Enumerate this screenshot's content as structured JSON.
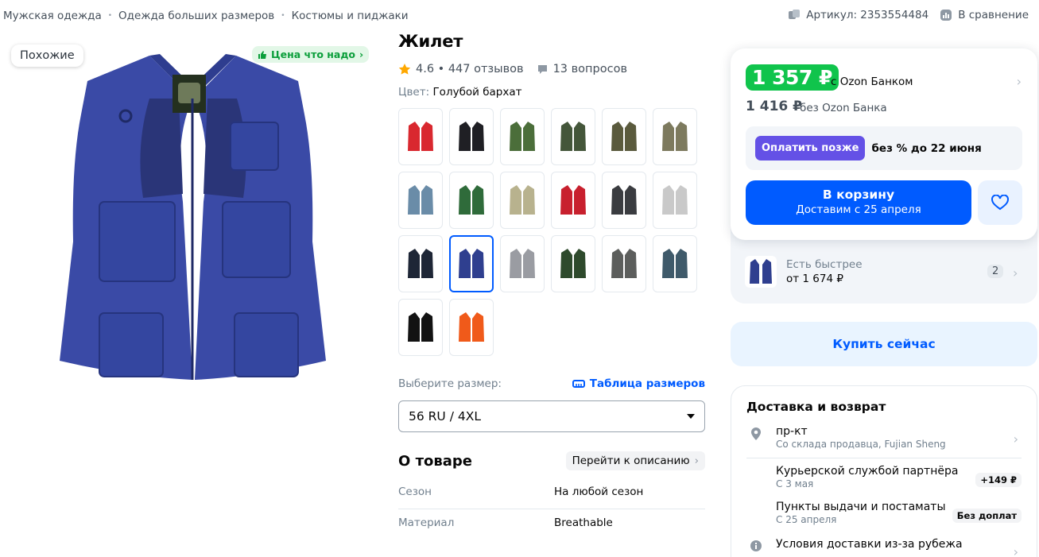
{
  "breadcrumbs": [
    "Мужская одежда",
    "Одежда больших размеров",
    "Костюмы и пиджаки"
  ],
  "article": "Артикул: 2353554484",
  "compare": "В сравнение",
  "gallery": {
    "similar": "Похожие",
    "badge": "Цена что надо"
  },
  "product": {
    "title": "Жилет",
    "rating": "4.6 • 447 отзывов",
    "questions": "13 вопросов",
    "color_label": "Цвет:",
    "color_value": "Голубой бархат"
  },
  "colors": {
    "swatches": [
      "#d9282f",
      "#1f1f24",
      "#4b6e3a",
      "#44563a",
      "#5a5a3d",
      "#7d7a5e",
      "#6a8ca8",
      "#2f6b3a",
      "#b8b28e",
      "#c8202e",
      "#3a3c40",
      "#c9c9c9",
      "#1e2636",
      "#2f3f8f",
      "#9a9ca2",
      "#2e4a2c",
      "#5c5e5c",
      "#3f5a6a",
      "#121212",
      "#f05a1a"
    ],
    "selected_index": 13
  },
  "size": {
    "label": "Выберите размер:",
    "table_link": "Таблица размеров",
    "selected": "56 RU / 4XL"
  },
  "about": {
    "title": "О товаре",
    "goto": "Перейти к описанию",
    "specs": [
      {
        "k": "Сезон",
        "v": "На любой сезон"
      },
      {
        "k": "Материал",
        "v": "Breathable"
      }
    ]
  },
  "buy": {
    "ozon_price": "1 357 ₽",
    "ozon_label": "с Ozon Банком",
    "old_price": "1 416 ₽",
    "old_label": "без Ozon Банка",
    "later_pill": "Оплатить позже",
    "later_text": "без % до 22 июня",
    "cart_l1": "В корзину",
    "cart_l2": "Доставим с 25 апреля",
    "faster_l1": "Есть быстрее",
    "faster_l2": "от 1 674 ₽",
    "faster_count": "2",
    "buy_now": "Купить сейчас"
  },
  "delivery": {
    "title": "Доставка и возврат",
    "rows": [
      {
        "l1": "пр-кт",
        "l2": "Со склада продавца, Fujian Sheng"
      },
      {
        "l1": "Курьерской службой партнёра",
        "l2": "С 3 мая",
        "tag": "+149 ₽"
      },
      {
        "l1": "Пункты выдачи и постаматы",
        "l2": "С 25 апреля",
        "tag": "Без доплат"
      },
      {
        "l1": "Условия доставки из-за рубежа"
      }
    ]
  },
  "colors_ui": {
    "brand": "#005bff",
    "green": "#10c44c",
    "violet": "#6451e6"
  }
}
